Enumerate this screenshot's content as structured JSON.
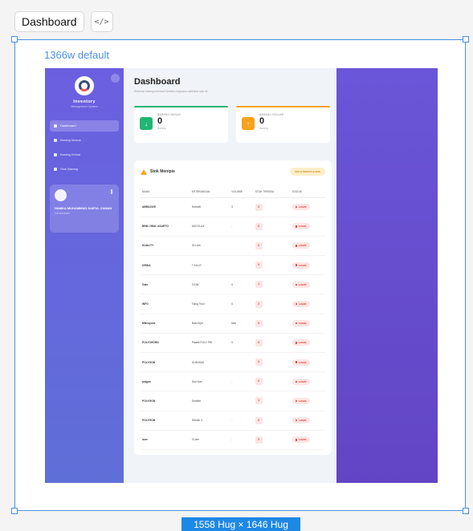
{
  "toolbar": {
    "title": "Dashboard",
    "code_label": "</>"
  },
  "frame": {
    "label": "1366w default",
    "size_badge": "1558 Hug × 1646 Hug"
  },
  "app": {
    "name": "Inventory",
    "subtitle": "Management System",
    "nav": [
      {
        "label": "Dashboard",
        "active": true
      },
      {
        "label": "Barang Masuk",
        "active": false
      },
      {
        "label": "Barang Keluar",
        "active": false
      },
      {
        "label": "Stok Barang",
        "active": false
      }
    ],
    "user": {
      "name": "HAMKA MUHAMMAD SAIFUL ZAMAN",
      "role": "Administrator"
    }
  },
  "page": {
    "title": "Dashboard",
    "desc": "Selamat datang kembali! Berikut ringkasan aktivitas hari ini"
  },
  "stats": [
    {
      "label": "BARANG MASUK",
      "value": "0",
      "unit": "Barang",
      "color": "#22b573",
      "icon": "↓"
    },
    {
      "label": "BARANG KELUAR",
      "value": "0",
      "unit": "Barang",
      "color": "#f7a21b",
      "icon": "↑"
    }
  ],
  "alert": {
    "title": "Stok Menipis",
    "button": "CEK & PESAN ULANG",
    "headers": [
      "NAMA",
      "KETERANGAN",
      "VOLUME",
      "STOK TERSISA",
      "STATUS"
    ],
    "rows": [
      {
        "name": "ABRASIVE",
        "ket": "Hotmelt",
        "vol": "0",
        "stok": "0",
        "status": "HABIS"
      },
      {
        "name": "BRM. HEAL ASARTO",
        "ket": "ASCOLUX",
        "vol": "-",
        "stok": "0",
        "status": "HABIS"
      },
      {
        "name": "DUALITY",
        "ket": "30 Litre",
        "vol": "",
        "stok": "0",
        "status": "HABIS"
      },
      {
        "name": "GRIDA",
        "ket": "7 KILLR",
        "vol": "",
        "stok": "0",
        "status": "HABIS"
      },
      {
        "name": "Gate",
        "ket": "3 KIM",
        "vol": "0",
        "stok": "1",
        "status": "HABIS"
      },
      {
        "name": "INFO",
        "ket": "Tiang Tinci",
        "vol": "0",
        "stok": "2",
        "status": "HABIS"
      },
      {
        "name": "Mikroyone",
        "ket": "Nasi Kipri",
        "vol": "kein",
        "stok": "0",
        "status": "HABIS"
      },
      {
        "name": "POLYCHORD",
        "ket": "Plastik POLY PRI",
        "vol": "0",
        "stok": "0",
        "status": "HABIS"
      },
      {
        "name": "POLYGON",
        "ket": "GUM BAS",
        "vol": "",
        "stok": "0",
        "status": "HABIS"
      },
      {
        "name": "potgon",
        "ket": "Gult Kan",
        "vol": "-",
        "stok": "0",
        "status": "HABIS"
      },
      {
        "name": "POLYGON",
        "ket": "Sandbit",
        "vol": "",
        "stok": "1",
        "status": "HABIS"
      },
      {
        "name": "POLYGON",
        "ket": "Stretch 4",
        "vol": "-",
        "stok": "0",
        "status": "HABIS"
      },
      {
        "name": "user",
        "ket": "3 Litre",
        "vol": "-",
        "stok": "2",
        "status": "HABIS"
      }
    ]
  }
}
